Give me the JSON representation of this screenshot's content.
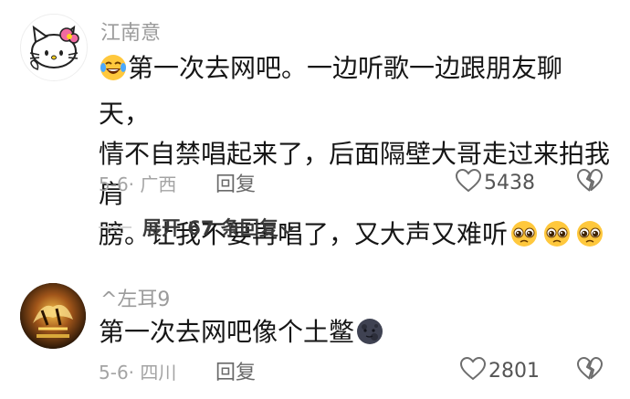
{
  "comments": [
    {
      "username": "江南意",
      "text_line1": "第一次去网吧。一边听歌一边跟朋友聊天，",
      "text_line2": "情不自禁唱起来了，后面隔壁大哥走过来拍我肩",
      "text_line3": "膀。让我不要再唱了，又大声又难听",
      "date_location": "5-6· 广西",
      "reply_label": "回复",
      "likes": "5438",
      "expand_label": "展开 67 条回复",
      "lead_emoji": "rofl-emoji",
      "trail_emoji": "pleading-face-emoji",
      "avatar": "hello-kitty-avatar"
    },
    {
      "username": "^左耳9",
      "text": "第一次去网吧像个土鳖",
      "date_location": "5-6· 四川",
      "reply_label": "回复",
      "likes": "2801",
      "trail_emoji": "new-moon-face-emoji",
      "avatar": "game-logo-avatar"
    }
  ]
}
